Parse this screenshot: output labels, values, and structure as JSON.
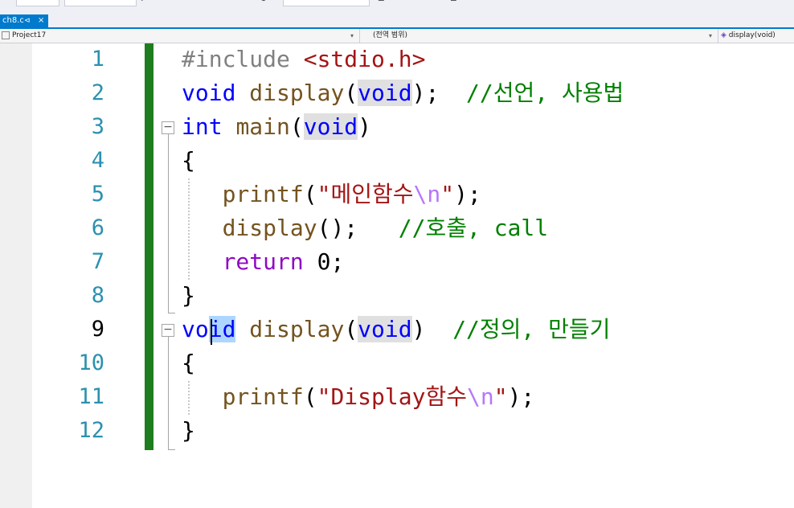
{
  "tab": {
    "filename": "ch8.c",
    "pin_glyph": "⊲",
    "close_glyph": "×"
  },
  "navbar": {
    "project": "Project17",
    "scope": "(전역 범위)",
    "member": "display(void)"
  },
  "lines": [
    {
      "num": "1"
    },
    {
      "num": "2"
    },
    {
      "num": "3"
    },
    {
      "num": "4"
    },
    {
      "num": "5"
    },
    {
      "num": "6"
    },
    {
      "num": "7"
    },
    {
      "num": "8"
    },
    {
      "num": "9"
    },
    {
      "num": "10"
    },
    {
      "num": "11"
    },
    {
      "num": "12"
    }
  ],
  "code": {
    "l1": {
      "directive": "#include ",
      "header": "<stdio.h>"
    },
    "l2": {
      "kw1": "void",
      "sp1": " ",
      "fn": "display",
      "p1": "(",
      "kw2": "void",
      "p2": ");",
      "sp2": "  ",
      "comment": "//선언, 사용법"
    },
    "l3": {
      "kw1": "int",
      "sp1": " ",
      "fn": "main",
      "p1": "(",
      "kw2": "void",
      "p2": ")"
    },
    "l4": {
      "brace": "{"
    },
    "l5": {
      "indent": "   ",
      "fn": "printf",
      "p1": "(",
      "str": "\"메인함수",
      "esc": "\\n",
      "str2": "\"",
      "p2": ");"
    },
    "l6": {
      "indent": "   ",
      "fn": "display",
      "p1": "();",
      "sp": "   ",
      "comment": "//호출, call"
    },
    "l7": {
      "indent": "   ",
      "kw": "return",
      "rest": " 0;"
    },
    "l8": {
      "brace": "}"
    },
    "l9": {
      "kw1a": "vo",
      "kw1b": "id",
      "sp1": " ",
      "fn": "display",
      "p1": "(",
      "kw2": "void",
      "p2": ")",
      "sp2": "  ",
      "comment": "//정의, 만들기"
    },
    "l10": {
      "brace": "{"
    },
    "l11": {
      "indent": "   ",
      "fn": "printf",
      "p1": "(",
      "str": "\"Display함수",
      "esc": "\\n",
      "str2": "\"",
      "p2": ");"
    },
    "l12": {
      "brace": "}"
    }
  },
  "fold": {
    "collapse_glyph": "−"
  },
  "colors": {
    "keyword": "#0000ff",
    "comment": "#008000",
    "string": "#a31515",
    "function": "#74531f",
    "accent": "#007acc",
    "change_bar": "#1e7d1e"
  }
}
